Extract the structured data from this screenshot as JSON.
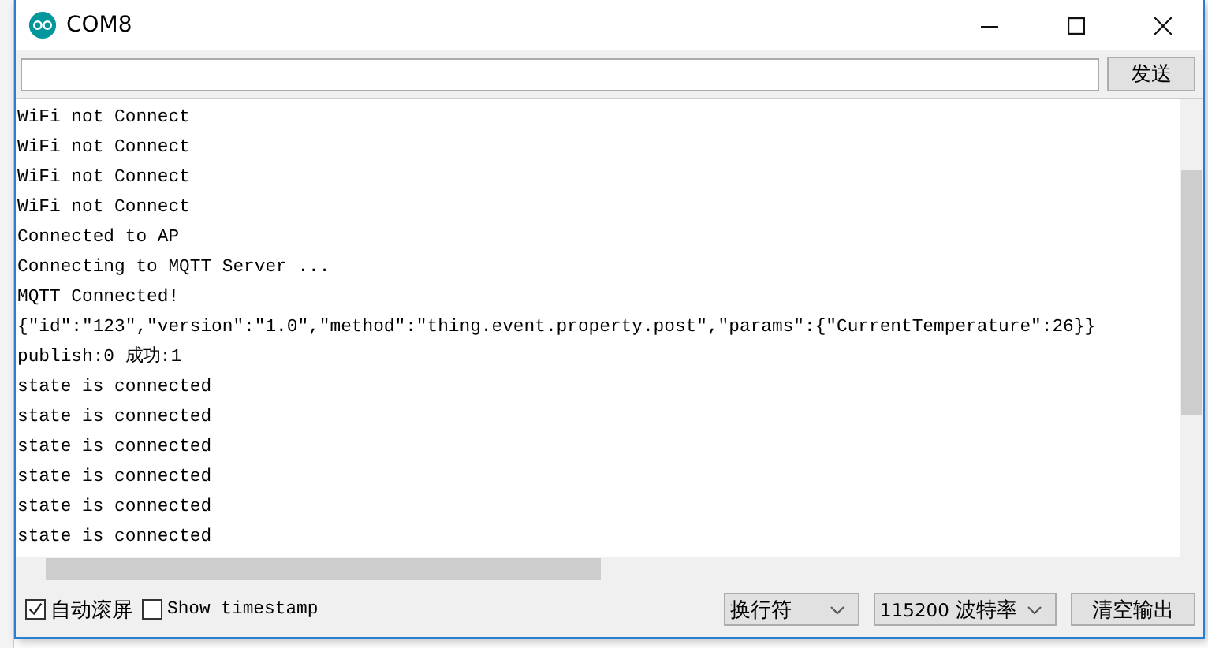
{
  "window": {
    "title": "COM8"
  },
  "send_button": "发送",
  "output_lines": [
    "WiFi not Connect",
    "WiFi not Connect",
    "WiFi not Connect",
    "WiFi not Connect",
    "Connected to AP",
    "Connecting to MQTT Server ...",
    "MQTT Connected!",
    "{\"id\":\"123\",\"version\":\"1.0\",\"method\":\"thing.event.property.post\",\"params\":{\"CurrentTemperature\":26}}",
    "publish:0 成功:1",
    "state is connected",
    "state is connected",
    "state is connected",
    "state is connected",
    "state is connected",
    "state is connected"
  ],
  "options": [
    {
      "label": "自动滚屏",
      "checked": true
    },
    {
      "label": "Show timestamp",
      "checked": false
    }
  ],
  "line_ending": "换行符",
  "baud_rate": {
    "value": "115200",
    "label": "波特率"
  },
  "clear_button": "清空输出"
}
